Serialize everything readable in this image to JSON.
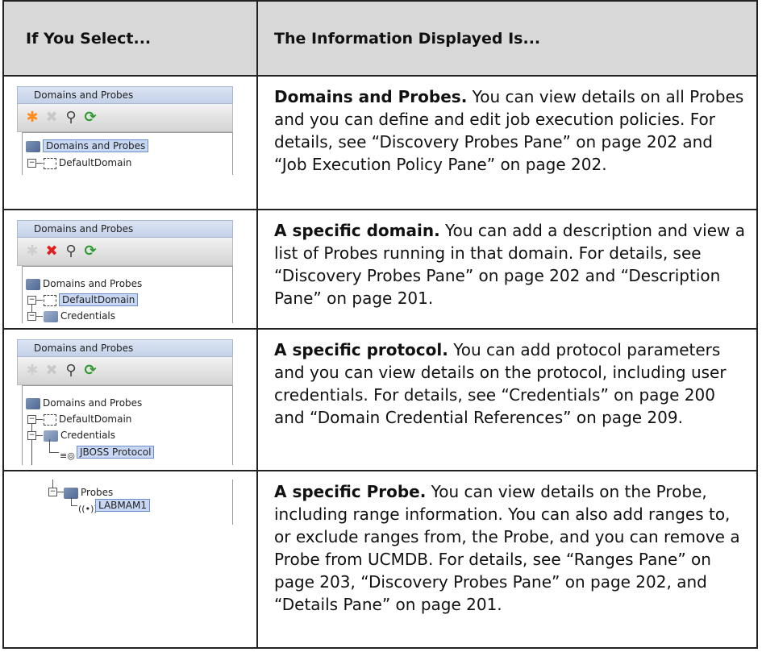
{
  "table": {
    "header_col1": "If You Select...",
    "header_col2": "The Information Displayed Is..."
  },
  "panel_title": "Domains and Probes",
  "rows": [
    {
      "tree": [
        "Domains and Probes",
        "DefaultDomain"
      ],
      "desc_bold": "Domains and Probes.",
      "desc_text": " You can view details on all Probes and you can define and edit job execution policies. For details, see “Discovery Probes Pane” on page 202 and “Job Execution Policy Pane” on page 202."
    },
    {
      "tree": [
        "Domains and Probes",
        "DefaultDomain",
        "Credentials"
      ],
      "desc_bold": "A specific domain.",
      "desc_text": " You can add a description and view a list of Probes running in that domain. For details, see “Discovery Probes Pane” on page 202 and “Description Pane” on page 201."
    },
    {
      "tree": [
        "Domains and Probes",
        "DefaultDomain",
        "Credentials",
        "JBOSS Protocol"
      ],
      "desc_bold": "A specific protocol.",
      "desc_text": " You can add protocol parameters and you can view details on the protocol, including user credentials. For details, see “Credentials” on page 200 and “Domain Credential References” on page 209."
    },
    {
      "tree": [
        "Probes",
        "LABMAM1"
      ],
      "desc_bold": "A specific Probe.",
      "desc_text": " You can view details on the Probe, including range information. You can also add ranges to, or exclude ranges from, the Probe, and you can remove a Probe from UCMDB. For details, see “Ranges Pane” on page 203, “Discovery Probes Pane” on page 202, and “Details Pane” on page 201."
    }
  ],
  "icons": {
    "add": "asterisk-icon",
    "delete": "x-icon",
    "search": "magnifier-icon",
    "refresh": "refresh-icon"
  }
}
